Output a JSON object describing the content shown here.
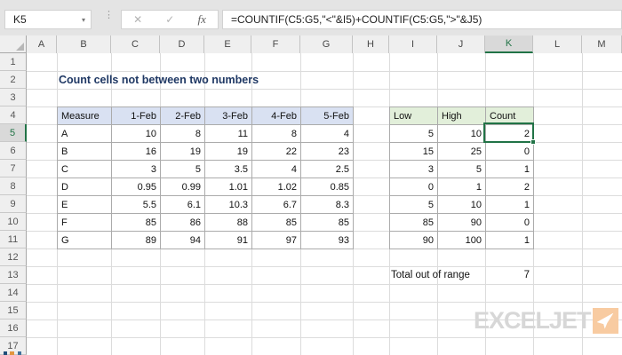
{
  "formula_bar": {
    "name_box": "K5",
    "namebox_dropdown_icon": "▾",
    "dots_icon": "⋮",
    "cancel_icon": "✕",
    "enter_icon": "✓",
    "fx_icon": "fx",
    "formula": "=COUNTIF(C5:G5,\"<\"&I5)+COUNTIF(C5:G5,\">\"&J5)"
  },
  "grid": {
    "column_headers": [
      "A",
      "B",
      "C",
      "D",
      "E",
      "F",
      "G",
      "H",
      "I",
      "J",
      "K",
      "L",
      "M"
    ],
    "row_headers": [
      "1",
      "2",
      "3",
      "4",
      "5",
      "6",
      "7",
      "8",
      "9",
      "10",
      "11",
      "12",
      "13",
      "14",
      "15",
      "16",
      "17"
    ],
    "selected_column": "K",
    "selected_row": "5"
  },
  "title": "Count cells not between two numbers",
  "measure_table": {
    "headers": [
      "Measure",
      "1-Feb",
      "2-Feb",
      "3-Feb",
      "4-Feb",
      "5-Feb"
    ],
    "rows": [
      [
        "A",
        "10",
        "8",
        "11",
        "8",
        "4"
      ],
      [
        "B",
        "16",
        "19",
        "19",
        "22",
        "23"
      ],
      [
        "C",
        "3",
        "5",
        "3.5",
        "4",
        "2.5"
      ],
      [
        "D",
        "0.95",
        "0.99",
        "1.01",
        "1.02",
        "0.85"
      ],
      [
        "E",
        "5.5",
        "6.1",
        "10.3",
        "6.7",
        "8.3"
      ],
      [
        "F",
        "85",
        "86",
        "88",
        "85",
        "85"
      ],
      [
        "G",
        "89",
        "94",
        "91",
        "97",
        "93"
      ]
    ]
  },
  "range_table": {
    "headers": [
      "Low",
      "High",
      "Count"
    ],
    "rows": [
      [
        "5",
        "10",
        "2"
      ],
      [
        "15",
        "25",
        "0"
      ],
      [
        "3",
        "5",
        "1"
      ],
      [
        "0",
        "1",
        "2"
      ],
      [
        "5",
        "10",
        "1"
      ],
      [
        "85",
        "90",
        "0"
      ],
      [
        "90",
        "100",
        "1"
      ]
    ],
    "selected_cell": {
      "ref": "K5",
      "row": 0,
      "col": 2,
      "value": "2"
    }
  },
  "summary": {
    "label": "Total out of range",
    "value": "7"
  },
  "logo": {
    "text": "EXCELJET"
  },
  "colors": {
    "accent_green": "#217346",
    "header_blue": "#D9E1F2",
    "header_green": "#E2EFDA",
    "title_navy": "#1F3864",
    "logo_gray": "#D7D7D7",
    "logo_orange": "#F8CBA1"
  }
}
